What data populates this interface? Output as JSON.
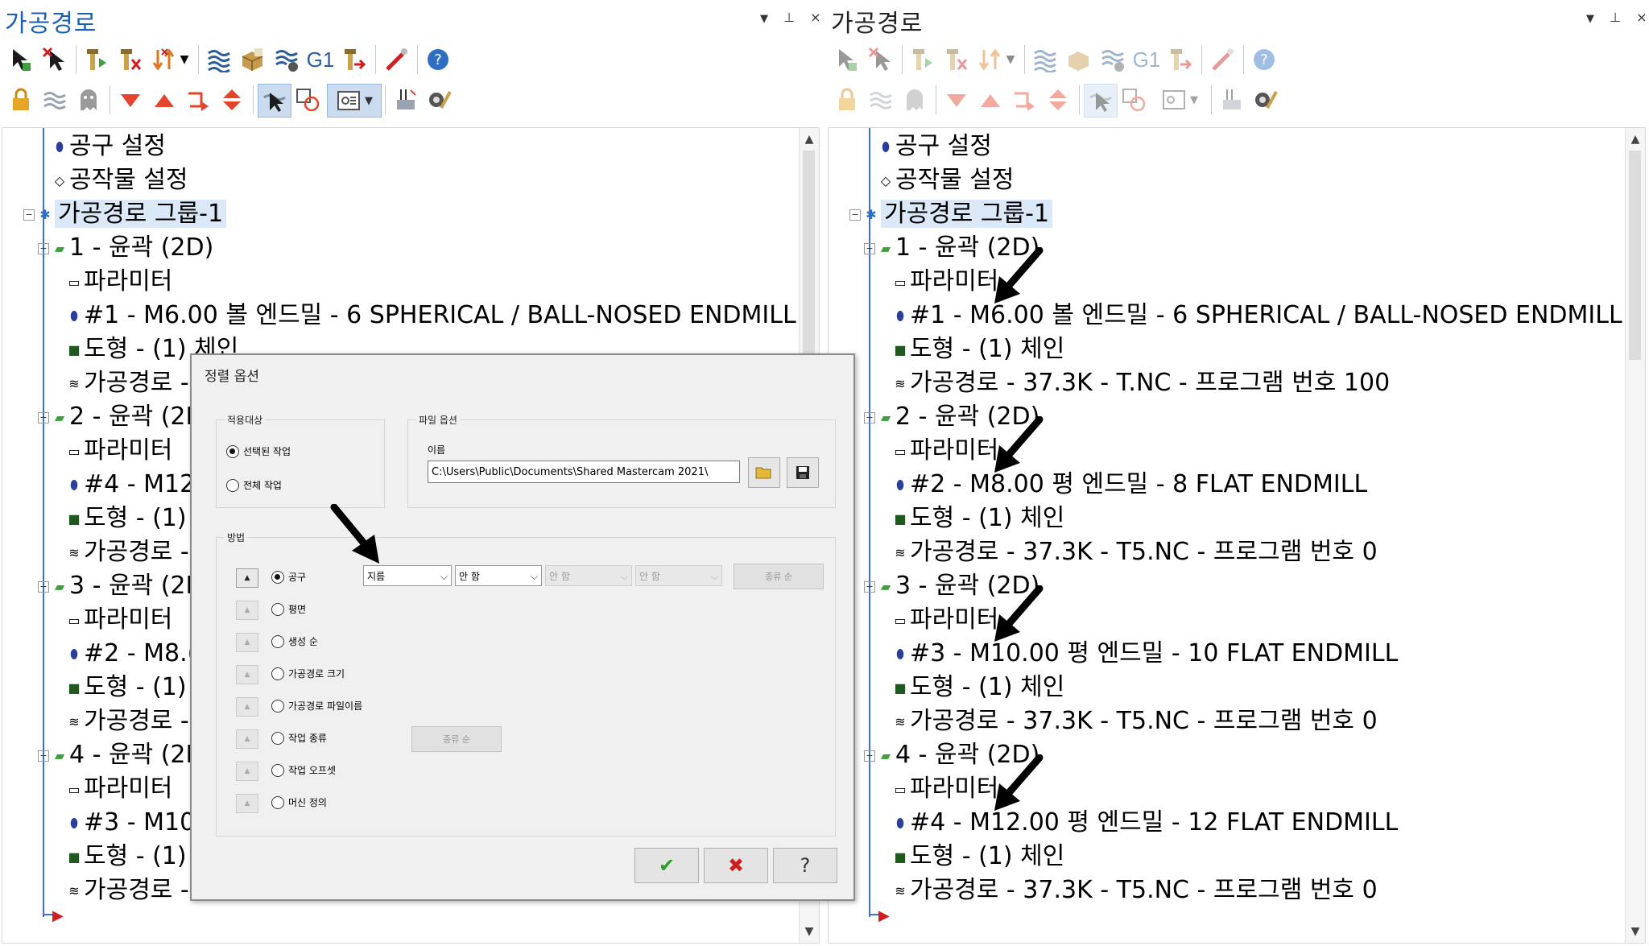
{
  "left": {
    "title": "가공경로",
    "controls": [
      "▼",
      "⊥",
      "×"
    ],
    "tree": {
      "setup_items": [
        "공구 설정",
        "공작물 설정"
      ],
      "group": "가공경로 그룹-1",
      "ops": [
        {
          "name": "1 - 윤곽 (2D)",
          "params": "파라미터",
          "tool": "#1 - M6.00 볼 엔드밀 - 6 SPHERICAL / BALL-NOSED ENDMILL",
          "geom": "도형 - (1) 체인",
          "path": "가공경로 - "
        },
        {
          "name": "2 - 윤곽 (2D",
          "params": "파라미터",
          "tool": "#4 - M12",
          "geom": "도형 - (1)",
          "path": "가공경로 - ."
        },
        {
          "name": "3 - 윤곽 (2D",
          "params": "파라미터",
          "tool": "#2 - M8.(",
          "geom": "도형 - (1)",
          "path": "가공경로 - ."
        },
        {
          "name": "4 - 윤곽 (2D",
          "params": "파라미터",
          "tool": "#3 - M10",
          "geom": "도형 - (1)",
          "path": "가공경로 - ."
        }
      ]
    }
  },
  "right": {
    "title": "가공경로",
    "controls": [
      "▼",
      "⊥",
      "×"
    ],
    "tree": {
      "setup_items": [
        "공구 설정",
        "공작물 설정"
      ],
      "group": "가공경로 그룹-1",
      "ops": [
        {
          "name": "1 - 윤곽 (2D)",
          "params": "파라미터",
          "tool": "#1 - M6.00 볼 엔드밀 - 6 SPHERICAL / BALL-NOSED ENDMILL",
          "geom": "도형 - (1) 체인",
          "path": "가공경로 - 37.3K - T.NC - 프로그램 번호 100"
        },
        {
          "name": "2 - 윤곽 (2D)",
          "params": "파라미터",
          "tool": "#2 - M8.00 평 엔드밀 - 8 FLAT ENDMILL",
          "geom": "도형 - (1) 체인",
          "path": "가공경로 - 37.3K - T5.NC - 프로그램 번호 0"
        },
        {
          "name": "3 - 윤곽 (2D)",
          "params": "파라미터",
          "tool": "#3 - M10.00 평 엔드밀 - 10 FLAT ENDMILL",
          "geom": "도형 - (1) 체인",
          "path": "가공경로 - 37.3K - T5.NC - 프로그램 번호 0"
        },
        {
          "name": "4 - 윤곽 (2D)",
          "params": "파라미터",
          "tool": "#4 - M12.00 평 엔드밀 - 12 FLAT ENDMILL",
          "geom": "도형 - (1) 체인",
          "path": "가공경로 - 37.3K - T5.NC - 프로그램 번호 0"
        }
      ]
    }
  },
  "toolbar_g1_label": "G1",
  "dialog": {
    "title": "정렬 옵션",
    "apply_group": "적용대상",
    "apply_options": [
      "선택된 작업",
      "전체 작업"
    ],
    "apply_selected_index": 0,
    "file_group": "파일 옵션",
    "name_label": "이름",
    "path_value": "C:\\Users\\Public\\Documents\\Shared Mastercam 2021\\",
    "method_group": "방법",
    "methods": [
      "공구",
      "평면",
      "생성 순",
      "가공경로 크기",
      "가공경로 파일이름",
      "작업 종류",
      "작업 오프셋",
      "머신 정의"
    ],
    "method_selected_index": 0,
    "combo1": "지름",
    "combo2": "안 함",
    "combo3": "안 함",
    "combo4": "안 함",
    "order_btn_1": "종류 순",
    "order_btn_2": "종류 순",
    "ok_glyph": "✔",
    "cancel_glyph": "✖",
    "help_glyph": "?"
  },
  "colors": {
    "title_blue": "#1a5fb4",
    "tree_line": "#3b6fd6",
    "ok_green": "#2e9d2e",
    "cancel_red": "#d21e1e"
  }
}
